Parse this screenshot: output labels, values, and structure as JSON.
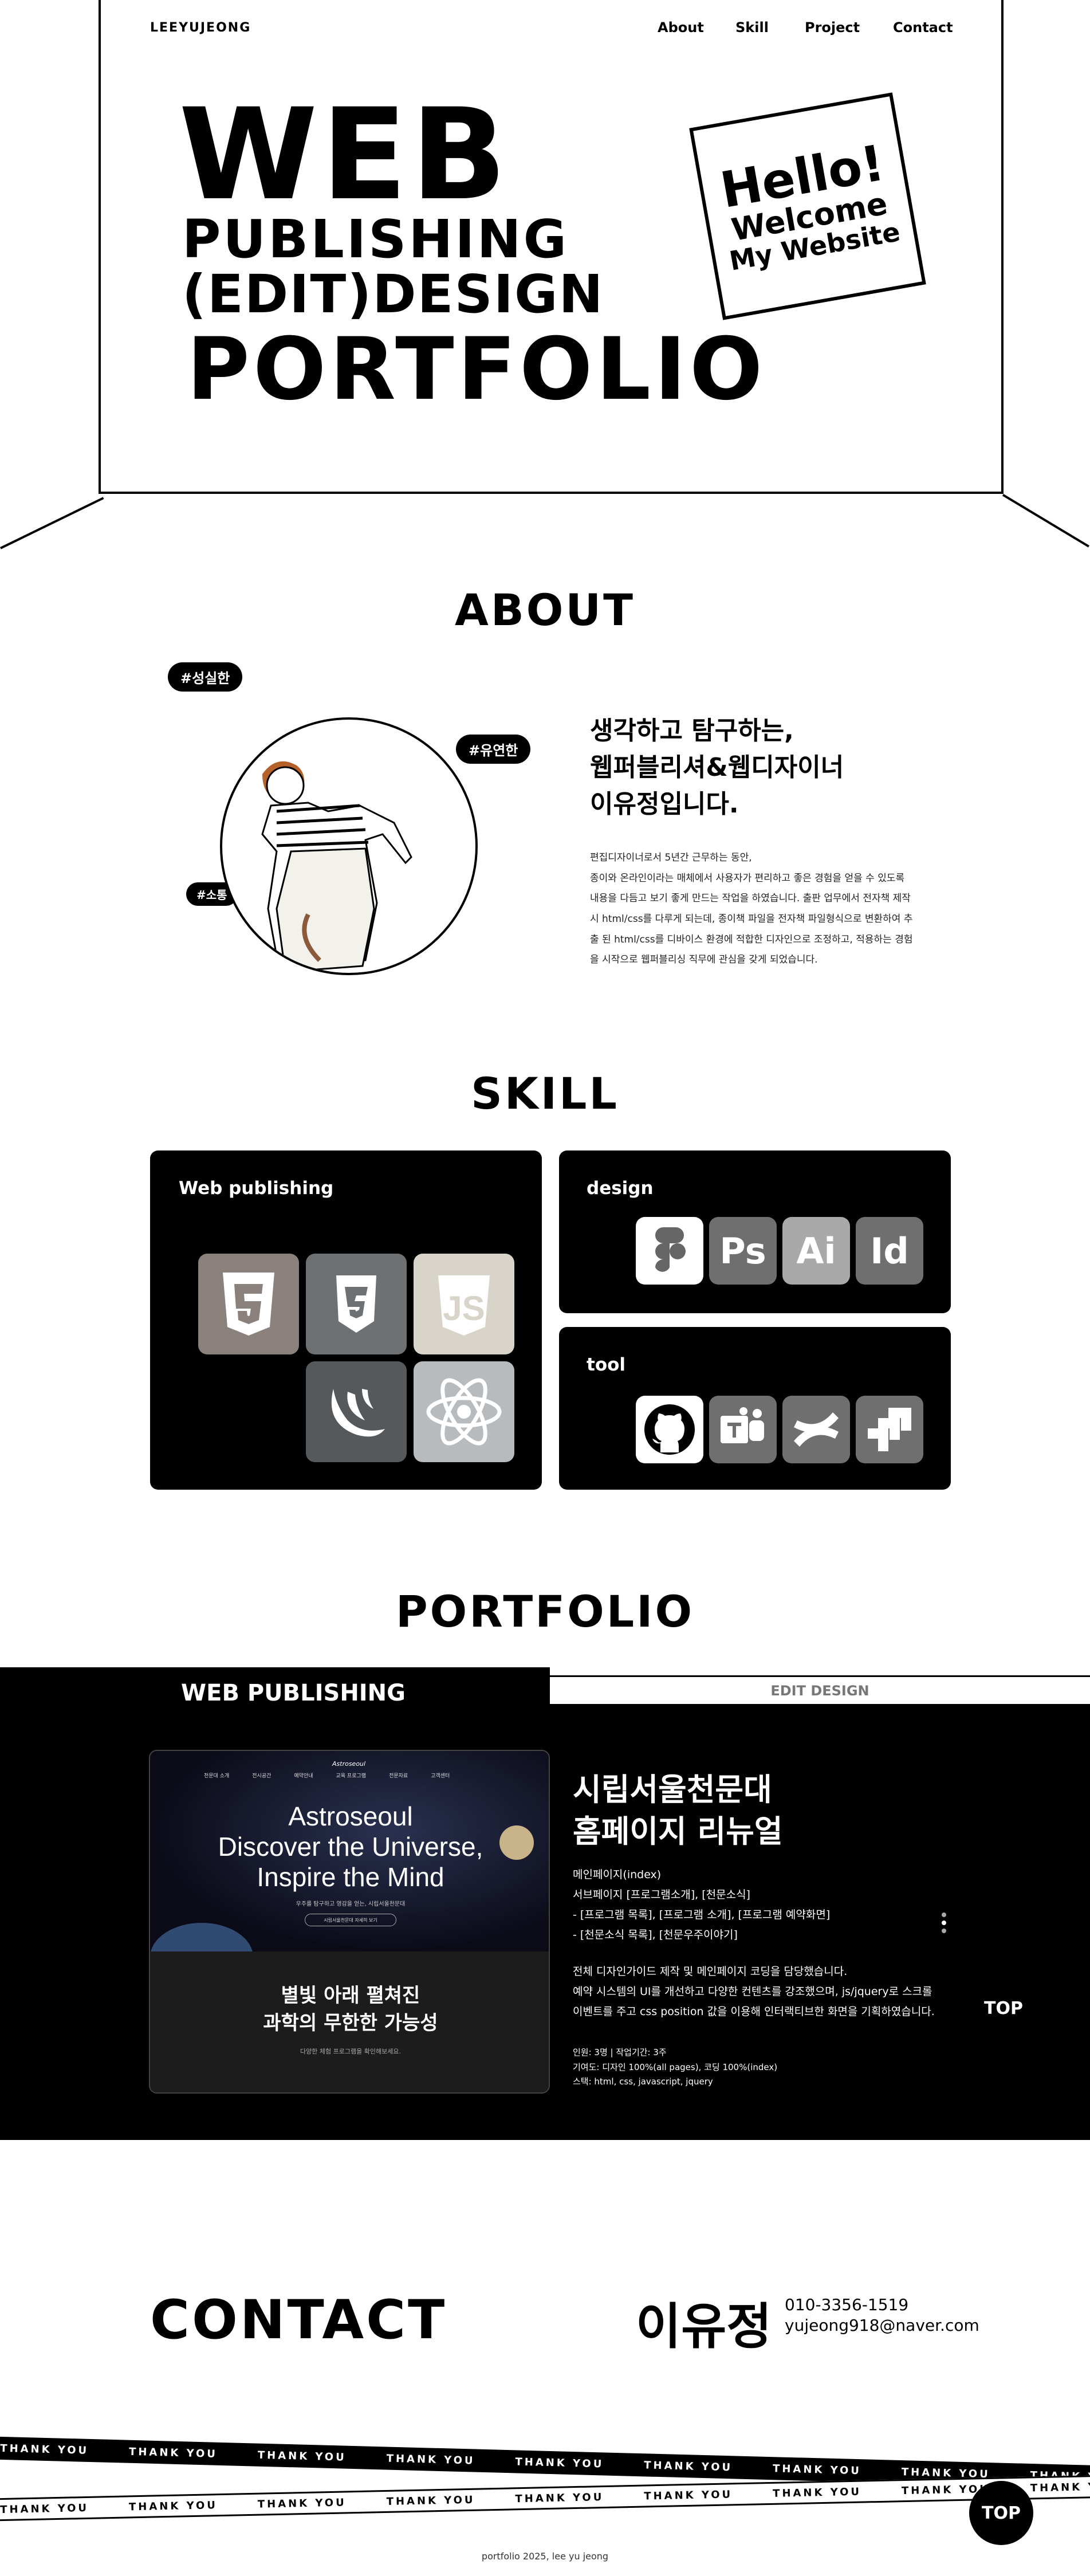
{
  "header": {
    "logo": "LEEYUJEONG",
    "nav": [
      "About",
      "Skill",
      "Project",
      "Contact"
    ]
  },
  "hero": {
    "line1": "WEB",
    "line2": "PUBLISHING",
    "line3": "(EDIT)DESIGN",
    "line4": "PORTFOLIO",
    "note": {
      "hello": "Hello!",
      "welcome": "Welcome",
      "my_website": "My Website"
    }
  },
  "about": {
    "title": "ABOUT",
    "tags": [
      "#성실한",
      "#유연한",
      "#소통"
    ],
    "headline": [
      "생각하고 탐구하는,",
      "웹퍼블리셔&웹디자이너",
      "이유정입니다."
    ],
    "body": [
      "편집디자이너로서 5년간 근무하는 동안,",
      "종이와 온라인이라는 매체에서 사용자가 편리하고 좋은 경험을 얻을 수 있도록",
      "내용을 다듬고 보기 좋게 만드는 작업을 하였습니다. 출판 업무에서 전자책 제작",
      "시 html/css를 다루게 되는데, 종이책 파일을 전자책 파일형식으로 변환하여 추",
      "출 된 html/css를 디바이스 환경에 적합한 디자인으로 조정하고, 적용하는 경험",
      "을 시작으로 웹퍼블리싱 직무에 관심을 갖게 되었습니다."
    ]
  },
  "skill": {
    "title": "SKILL",
    "web_publishing": {
      "label": "Web publishing",
      "icons": [
        "html5-icon",
        "css3-icon",
        "javascript-icon",
        "jquery-icon",
        "react-icon"
      ]
    },
    "design": {
      "label": "design",
      "icons": [
        {
          "name": "figma-icon",
          "text": ""
        },
        {
          "name": "photoshop-icon",
          "text": "Ps"
        },
        {
          "name": "illustrator-icon",
          "text": "Ai"
        },
        {
          "name": "indesign-icon",
          "text": "Id"
        }
      ]
    },
    "tool": {
      "label": "tool",
      "icons": [
        "github-icon",
        "teams-icon",
        "confluence-icon",
        "jira-icon"
      ]
    },
    "colors": {
      "html": "#8a817c",
      "css": "#6e7174",
      "js": "#d9d4c9",
      "jquery": "#55595c",
      "react": "#b8bbbe"
    }
  },
  "portfolio": {
    "title": "PORTFOLIO",
    "tab_web": "WEB PUBLISHING",
    "tab_edit": "EDIT DESIGN",
    "mock": {
      "nav": [
        "천문대 소개",
        "전시공간",
        "예약안내",
        "교육 프로그램",
        "전문자료",
        "고객센터"
      ],
      "brand": "Astroseoul",
      "heading": [
        "Astroseoul",
        "Discover the Universe,",
        "Inspire the Mind"
      ],
      "sub": "우주를 탐구하고 영감을 얻는, 시립서울천문대",
      "btn": "시립서울천문대 자세히 보기",
      "lower": [
        "별빛 아래 펼쳐진",
        "과학의 무한한 가능성"
      ],
      "lower_sub": "다양한 체험 프로그램을 확인해보세요."
    },
    "project_title": [
      "시립서울천문대",
      "홈페이지 리뉴얼"
    ],
    "details": [
      "메인페이지(index)",
      "서브페이지 [프로그램소개], [천문소식]",
      "- [프로그램 목록], [프로그램 소개], [프로그램 예약화면]",
      "- [천문소식 목록], [천문우주이야기]"
    ],
    "description": [
      "전체 디자인가이드 제작 및 메인페이지 코딩을 담당했습니다.",
      "예약 시스템의 UI를 개선하고 다양한 컨텐츠를 강조했으며, js/jquery로 스크롤",
      "이벤트를 주고 css position 값을 이용해 인터랙티브한 화면을 기획하였습니다."
    ],
    "meta": [
      "인원: 3명 | 작업기간: 3주",
      "기여도: 디자인 100%(all pages), 코딩 100%(index)",
      "스택: html, css, javascript, jquery"
    ],
    "side_top": "TOP"
  },
  "contact": {
    "title": "CONTACT",
    "name": "이유정",
    "phone": "010-3356-1519",
    "email": "yujeong918@naver.com"
  },
  "tape_text": "THANK YOU",
  "top_button": "TOP",
  "footer": "portfolio 2025, lee yu jeong"
}
